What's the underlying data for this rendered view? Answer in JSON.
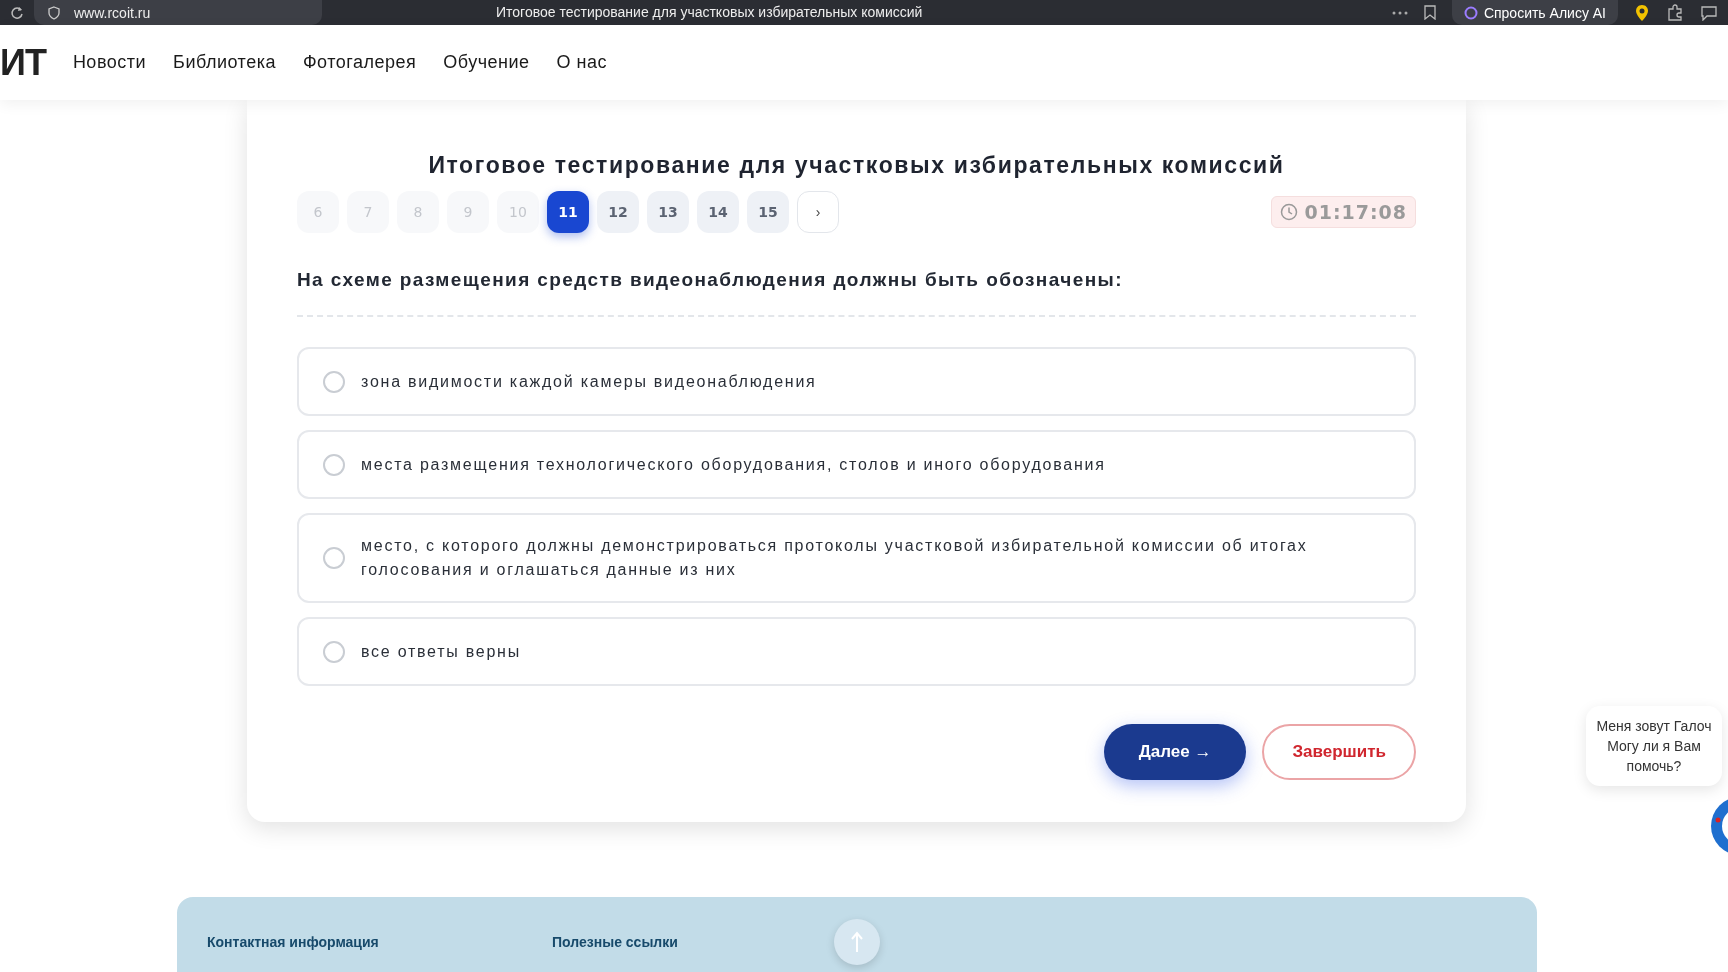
{
  "browser": {
    "url": "www.rcoit.ru",
    "title": "Итоговое тестирование для участковых избирательных комиссий",
    "assistant_button": "Спросить Алису AI"
  },
  "nav": {
    "logo": "ИТ",
    "items": [
      "Новости",
      "Библиотека",
      "Фотогалерея",
      "Обучение",
      "О нас"
    ]
  },
  "test": {
    "title": "Итоговое тестирование для участковых избирательных комиссий",
    "pages": [
      {
        "label": "6",
        "selected": false,
        "disabled": true
      },
      {
        "label": "7",
        "selected": false,
        "disabled": true
      },
      {
        "label": "8",
        "selected": false,
        "disabled": true
      },
      {
        "label": "9",
        "selected": false,
        "disabled": true
      },
      {
        "label": "10",
        "selected": false,
        "disabled": true
      },
      {
        "label": "11",
        "selected": true,
        "disabled": false
      },
      {
        "label": "12",
        "selected": false,
        "disabled": false
      },
      {
        "label": "13",
        "selected": false,
        "disabled": false
      },
      {
        "label": "14",
        "selected": false,
        "disabled": false
      },
      {
        "label": "15",
        "selected": false,
        "disabled": false
      }
    ],
    "next_page": "›",
    "timer": "01:17:08",
    "question": "На схеме размещения средств видеонаблюдения должны быть обозначены:",
    "answers": [
      {
        "text": "зона видимости каждой камеры видеонаблюдения",
        "selected": false
      },
      {
        "text": "места размещения технологического оборудования, столов и иного оборудования",
        "selected": false
      },
      {
        "text": "место, с которого должны демонстрироваться протоколы участковой избирательной комиссии об итогах голосования и оглашаться данные из них",
        "selected": false
      },
      {
        "text": "все ответы верны",
        "selected": false
      }
    ],
    "next_button": "Далее →",
    "finish_button": "Завершить"
  },
  "chat": {
    "lines": [
      "Меня зовут Галоч",
      "Могу ли я Вам",
      "помочь?"
    ]
  },
  "footer": {
    "columns": [
      "Контактная информация",
      "Полезные ссылки"
    ]
  }
}
